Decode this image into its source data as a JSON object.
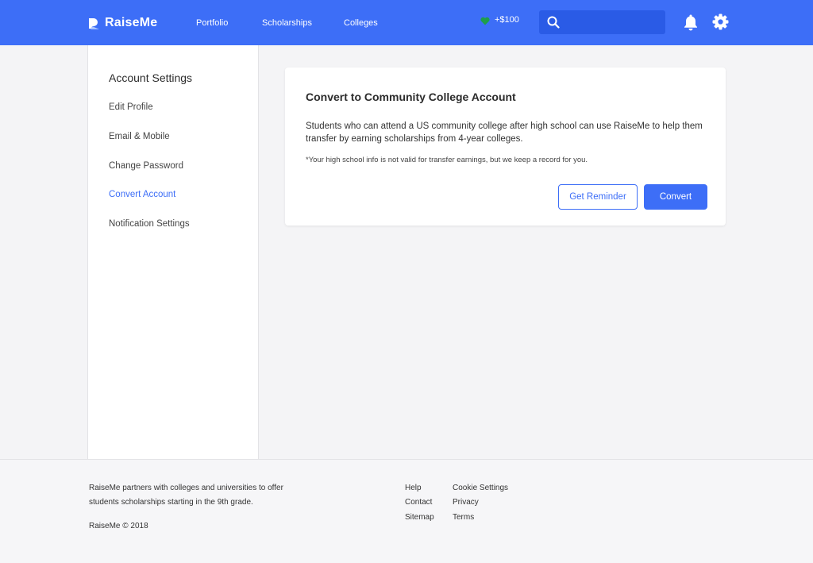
{
  "header": {
    "brand": "RaiseMe",
    "nav": [
      "Portfolio",
      "Scholarships",
      "Colleges"
    ],
    "earnings": "+$100",
    "search_value": "",
    "colors": {
      "bar": "#3d6ef7",
      "search": "#2a5be6",
      "earnings_heart": "#1e9e4a"
    }
  },
  "sidebar": {
    "title": "Account Settings",
    "items": [
      "Edit Profile",
      "Email & Mobile",
      "Change Password",
      "Convert Account",
      "Notification Settings"
    ],
    "active_item": "Convert Account"
  },
  "card": {
    "title": "Convert to Community College Account",
    "description": "Students who can attend a US community college after high school can use RaiseMe to help them transfer by earning scholarships from 4-year colleges.",
    "note": "*Your high school info is not valid for transfer earnings, but we keep a record for you.",
    "reminder_label": "Get Reminder",
    "convert_label": "Convert"
  },
  "footer": {
    "about_line1": "RaiseMe partners with colleges and universities to offer",
    "about_line2": "students scholarships starting in the 9th grade.",
    "copyright": "RaiseMe © 2018",
    "links_col1": [
      "Help",
      "Contact",
      "Sitemap"
    ],
    "links_col2": [
      "Cookie Settings",
      "Privacy",
      "Terms"
    ]
  }
}
